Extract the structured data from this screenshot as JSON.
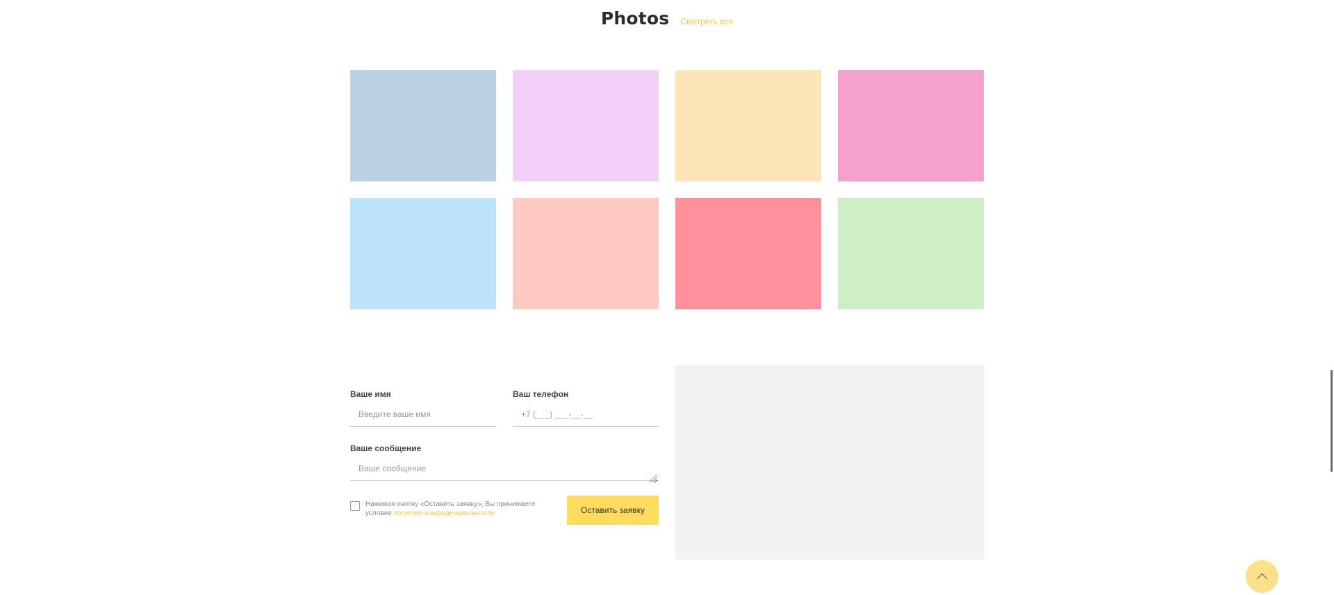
{
  "header": {
    "title": "Photos",
    "view_all": "Смотреть все"
  },
  "gallery": {
    "tiles": [
      {
        "color": "#bad2e4"
      },
      {
        "color": "#f2d0f7"
      },
      {
        "color": "#fee5b8"
      },
      {
        "color": "#f4a1cd"
      },
      {
        "color": "#bde4f9"
      },
      {
        "color": "#fec9c0"
      },
      {
        "color": "#fe919b"
      },
      {
        "color": "#cfeec6"
      }
    ]
  },
  "form": {
    "name_label": "Ваше имя",
    "name_placeholder": "Введите ваше имя",
    "phone_label": "Ваш телефон",
    "phone_placeholder": "+7 (___) ___-__-__",
    "message_label": "Ваше сообщение",
    "message_placeholder": "Ваше сообщение",
    "consent_text": "Нажимая кнопку «Оставить заявку», Вы принимаете условия ",
    "policy_link": "политики конфиденциальности",
    "submit_label": "Оставить заявку"
  },
  "colors": {
    "accent": "#f2c94c",
    "button": "#ffdc5e",
    "scroll_top_button": "#ffe08a",
    "map_placeholder": "#f2f2f2"
  },
  "icons": {
    "scroll_top": "chevron-up-icon"
  }
}
